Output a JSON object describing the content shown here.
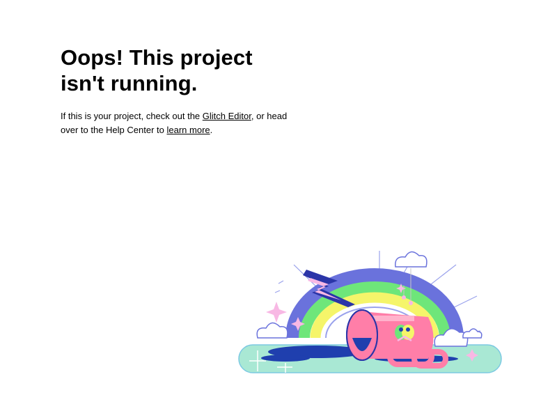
{
  "error_page": {
    "heading": "Oops! This project isn't running.",
    "message": {
      "part1": "If this is your project, check out the ",
      "editor_link": "Glitch Editor",
      "part2": ", or head over to the Help Center to ",
      "learn_more_link": "learn more",
      "part3": "."
    }
  },
  "illustration": {
    "icon": "broken-rainbow-illustration",
    "colors": {
      "rainbow_outer": "#6a72dc",
      "rainbow_green": "#6ee67a",
      "rainbow_yellow": "#f5f56a",
      "bolt": "#2b35a8",
      "pipe": "#ff7ea8",
      "ground": "#a9e8d4",
      "puddle": "#1f3fae"
    }
  }
}
